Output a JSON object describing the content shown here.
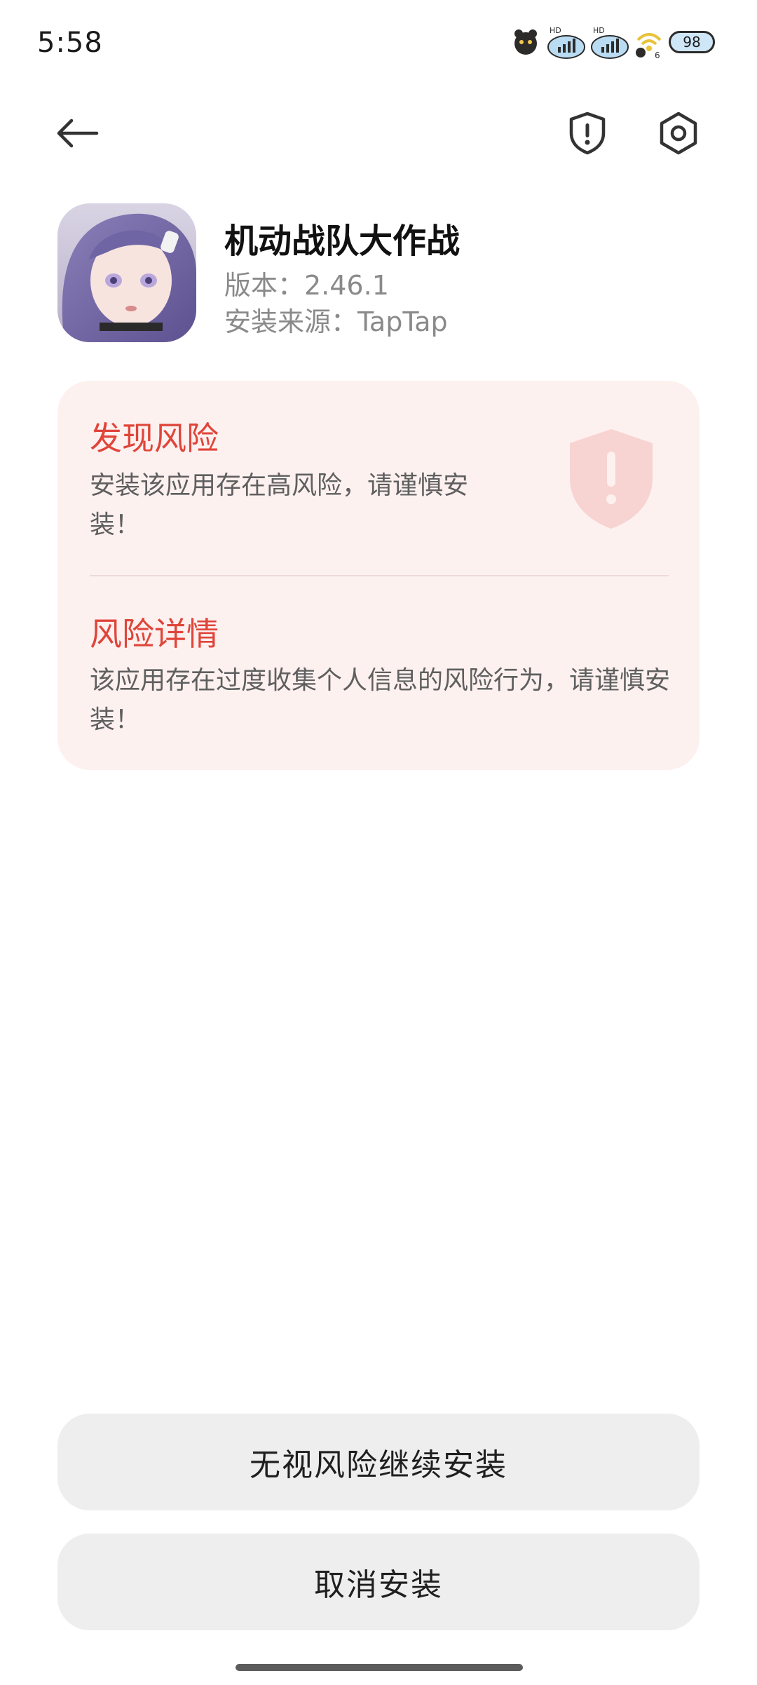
{
  "status_bar": {
    "time": "5:58",
    "battery_level": "98",
    "wifi_label": "6",
    "signal_label_1": "HD",
    "signal_label_2": "HD"
  },
  "nav": {
    "back_icon": "arrow-left-icon",
    "security_icon": "shield-exclamation-icon",
    "settings_icon": "gear-icon"
  },
  "app": {
    "name": "机动战队大作战",
    "version": "版本：2.46.1",
    "source": "安装来源：TapTap"
  },
  "risk_card": {
    "title": "发现风险",
    "message": "安装该应用存在高风险，请谨慎安装！",
    "details_title": "风险详情",
    "details_message": "该应用存在过度收集个人信息的风险行为，请谨慎安装！",
    "accent_color": "#e0453a",
    "background_color": "#fdf1f0"
  },
  "actions": {
    "continue_label": "无视风险继续安装",
    "cancel_label": "取消安装"
  }
}
